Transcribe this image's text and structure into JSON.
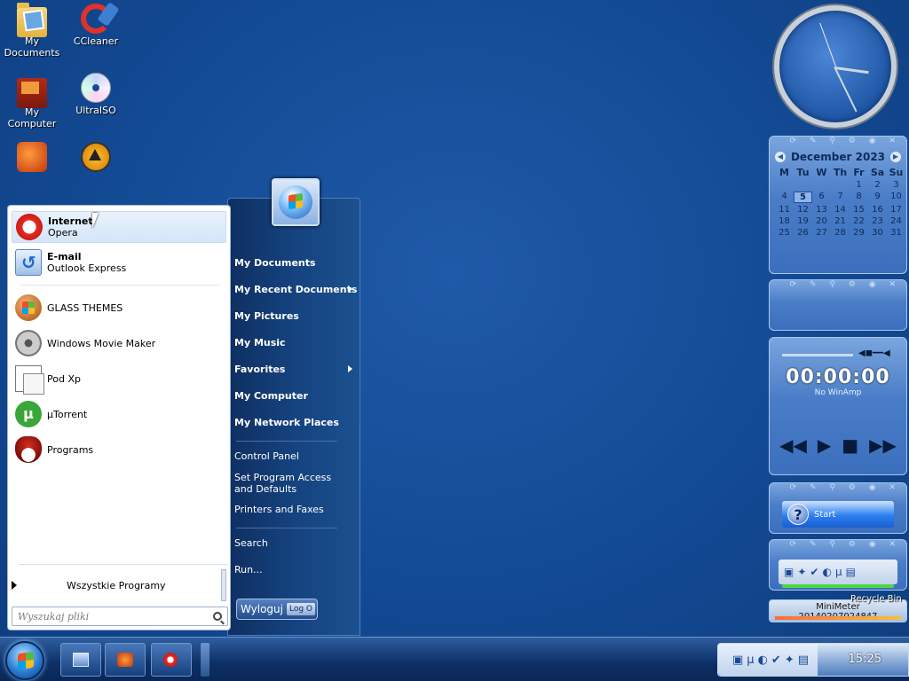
{
  "desktop": {
    "icons": [
      {
        "label": "My Documents",
        "icon": "folder-icon"
      },
      {
        "label": "CCleaner",
        "icon": "ccleaner-icon"
      },
      {
        "label": "My Computer",
        "icon": "computer-icon"
      },
      {
        "label": "UltraISO",
        "icon": "disc-icon"
      },
      {
        "label": "",
        "icon": "app-icon"
      },
      {
        "label": "",
        "icon": "aimp-icon"
      }
    ]
  },
  "calendar": {
    "month_year": "December 2023",
    "days_of_week": [
      "M",
      "Tu",
      "W",
      "Th",
      "Fr",
      "Sa",
      "Su"
    ],
    "today": "5",
    "weeks": [
      [
        "",
        "",
        "",
        "",
        "1",
        "2",
        "3"
      ],
      [
        "4",
        "5",
        "6",
        "7",
        "8",
        "9",
        "10"
      ],
      [
        "11",
        "12",
        "13",
        "14",
        "15",
        "16",
        "17"
      ],
      [
        "18",
        "19",
        "20",
        "21",
        "22",
        "23",
        "24"
      ],
      [
        "25",
        "26",
        "27",
        "28",
        "29",
        "30",
        "31"
      ]
    ]
  },
  "winamp": {
    "time": "00:00:00",
    "status": "No WinAmp",
    "controls": [
      "◀◀",
      "▶",
      "■",
      "▶▶"
    ]
  },
  "launcher": {
    "label": "Start"
  },
  "minimeter": {
    "title": "MiniMeter",
    "value": "20140207024847"
  },
  "recycle_bin": "Recycle Bin",
  "start_menu": {
    "pinned": [
      {
        "title": "Internet",
        "subtitle": "Opera"
      },
      {
        "title": "E-mail",
        "subtitle": "Outlook Express"
      }
    ],
    "recent": [
      "GLASS THEMES",
      "Windows Movie Maker",
      "Pod Xp",
      "µTorrent",
      "Programs"
    ],
    "all_programs": "Wszystkie Programy",
    "search_placeholder": "Wyszukaj pliki",
    "right_items": [
      "My Documents",
      "My Recent Documents",
      "My Pictures",
      "My Music",
      "Favorites",
      "My Computer",
      "My Network Places",
      "Control Panel",
      "Set Program Access and Defaults",
      "Printers and Faxes",
      "Search",
      "Run..."
    ],
    "logoff": "Wyloguj",
    "logoff_small": "Log O"
  },
  "taskbar": {
    "clock": "15:25"
  }
}
